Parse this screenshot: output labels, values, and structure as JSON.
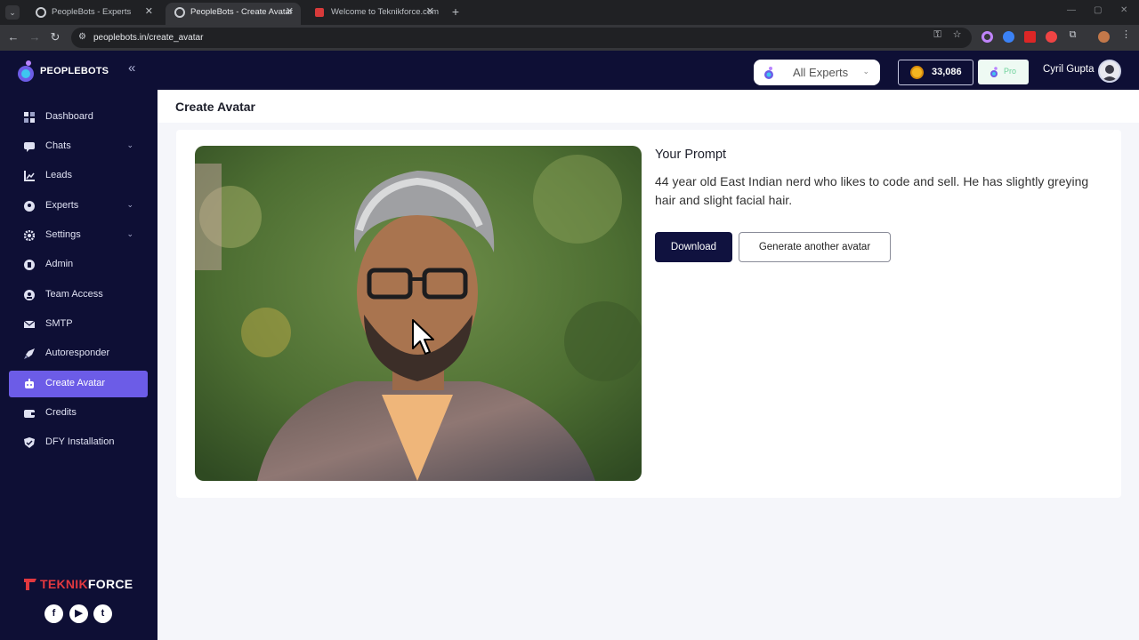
{
  "browser": {
    "tabs": [
      {
        "title": "PeopleBots - Experts",
        "active": false
      },
      {
        "title": "PeopleBots - Create Avatar",
        "active": true
      },
      {
        "title": "Welcome to Teknikforce.com",
        "active": false
      }
    ],
    "url": "peoplebots.in/create_avatar"
  },
  "sidebar": {
    "logo_text": "PEOPLEBOTS",
    "items": [
      {
        "label": "Dashboard",
        "icon": "grid-icon",
        "has_submenu": false,
        "active": false
      },
      {
        "label": "Chats",
        "icon": "chat-icon",
        "has_submenu": true,
        "active": false
      },
      {
        "label": "Leads",
        "icon": "leads-chart-icon",
        "has_submenu": false,
        "active": false
      },
      {
        "label": "Experts",
        "icon": "experts-icon",
        "has_submenu": true,
        "active": false
      },
      {
        "label": "Settings",
        "icon": "gear-icon",
        "has_submenu": true,
        "active": false
      },
      {
        "label": "Admin",
        "icon": "admin-icon",
        "has_submenu": false,
        "active": false
      },
      {
        "label": "Team Access",
        "icon": "team-icon",
        "has_submenu": false,
        "active": false
      },
      {
        "label": "SMTP",
        "icon": "mail-icon",
        "has_submenu": false,
        "active": false
      },
      {
        "label": "Autoresponder",
        "icon": "rocket-icon",
        "has_submenu": false,
        "active": false
      },
      {
        "label": "Create Avatar",
        "icon": "robot-icon",
        "has_submenu": false,
        "active": true
      },
      {
        "label": "Credits",
        "icon": "wallet-icon",
        "has_submenu": false,
        "active": false
      },
      {
        "label": "DFY Installation",
        "icon": "shield-check-icon",
        "has_submenu": false,
        "active": false
      }
    ],
    "footer_brand": {
      "part1": "TEKNIK",
      "part2": "FORCE"
    },
    "social": [
      "facebook-icon",
      "youtube-icon",
      "twitter-icon"
    ]
  },
  "topbar": {
    "expert_select": "All Experts",
    "credits": "33,086",
    "plan": "Pro",
    "user_name": "Cyril Gupta"
  },
  "page": {
    "title": "Create Avatar",
    "prompt_heading": "Your Prompt",
    "prompt_text": "44 year old East Indian nerd who likes to code and sell. He has slightly greying hair and slight facial hair.",
    "download_label": "Download",
    "generate_label": "Generate another avatar"
  },
  "colors": {
    "sidebar_bg": "#0e0f35",
    "accent_active": "#6c5ce7",
    "primary_button": "#10123f",
    "brand_red": "#e2383f"
  }
}
